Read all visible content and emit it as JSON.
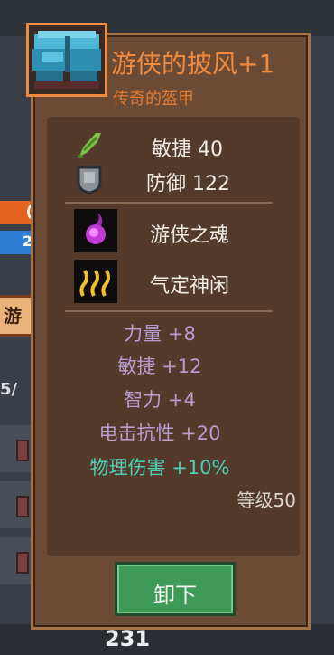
{
  "background": {
    "bar_a_value": "(",
    "bar_b_value": "2",
    "side_tab_label": "游",
    "side_text": "5/",
    "bottom_number": "231"
  },
  "tooltip": {
    "item_name": "游侠的披风+1",
    "item_rarity": "传奇的盔甲",
    "icon": "blue-cloak-icon",
    "stats": [
      {
        "icon": "feather-agility-icon",
        "label": "敏捷 40"
      },
      {
        "icon": "shield-defense-icon",
        "label": "防御 122"
      }
    ],
    "skills": [
      {
        "icon": "purple-soul-orb-icon",
        "label": "游侠之魂"
      },
      {
        "icon": "steam-calm-icon",
        "label": "气定神闲"
      }
    ],
    "bonuses": [
      "力量 +8",
      "敏捷 +12",
      "智力 +4",
      "电击抗性 +20",
      "物理伤害 +10%"
    ],
    "level": "等级50",
    "unequip_label": "卸下"
  },
  "colors": {
    "legendary": "#f08a3e",
    "bonus_text": "#b89ccf",
    "special_bonus_text": "#4fd0b4",
    "button_green": "#3f9a57"
  }
}
